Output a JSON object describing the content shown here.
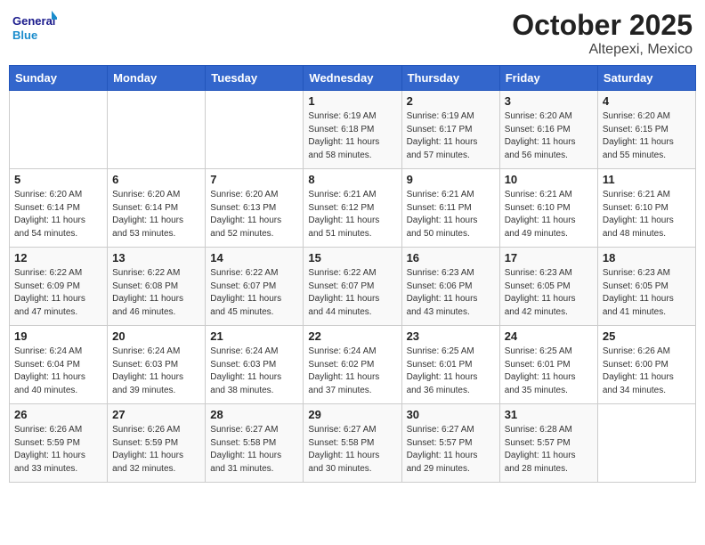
{
  "header": {
    "logo_line1": "General",
    "logo_line2": "Blue",
    "month_title": "October 2025",
    "location": "Altepexi, Mexico"
  },
  "days_of_week": [
    "Sunday",
    "Monday",
    "Tuesday",
    "Wednesday",
    "Thursday",
    "Friday",
    "Saturday"
  ],
  "weeks": [
    [
      {
        "day": "",
        "info": ""
      },
      {
        "day": "",
        "info": ""
      },
      {
        "day": "",
        "info": ""
      },
      {
        "day": "1",
        "info": "Sunrise: 6:19 AM\nSunset: 6:18 PM\nDaylight: 11 hours\nand 58 minutes."
      },
      {
        "day": "2",
        "info": "Sunrise: 6:19 AM\nSunset: 6:17 PM\nDaylight: 11 hours\nand 57 minutes."
      },
      {
        "day": "3",
        "info": "Sunrise: 6:20 AM\nSunset: 6:16 PM\nDaylight: 11 hours\nand 56 minutes."
      },
      {
        "day": "4",
        "info": "Sunrise: 6:20 AM\nSunset: 6:15 PM\nDaylight: 11 hours\nand 55 minutes."
      }
    ],
    [
      {
        "day": "5",
        "info": "Sunrise: 6:20 AM\nSunset: 6:14 PM\nDaylight: 11 hours\nand 54 minutes."
      },
      {
        "day": "6",
        "info": "Sunrise: 6:20 AM\nSunset: 6:14 PM\nDaylight: 11 hours\nand 53 minutes."
      },
      {
        "day": "7",
        "info": "Sunrise: 6:20 AM\nSunset: 6:13 PM\nDaylight: 11 hours\nand 52 minutes."
      },
      {
        "day": "8",
        "info": "Sunrise: 6:21 AM\nSunset: 6:12 PM\nDaylight: 11 hours\nand 51 minutes."
      },
      {
        "day": "9",
        "info": "Sunrise: 6:21 AM\nSunset: 6:11 PM\nDaylight: 11 hours\nand 50 minutes."
      },
      {
        "day": "10",
        "info": "Sunrise: 6:21 AM\nSunset: 6:10 PM\nDaylight: 11 hours\nand 49 minutes."
      },
      {
        "day": "11",
        "info": "Sunrise: 6:21 AM\nSunset: 6:10 PM\nDaylight: 11 hours\nand 48 minutes."
      }
    ],
    [
      {
        "day": "12",
        "info": "Sunrise: 6:22 AM\nSunset: 6:09 PM\nDaylight: 11 hours\nand 47 minutes."
      },
      {
        "day": "13",
        "info": "Sunrise: 6:22 AM\nSunset: 6:08 PM\nDaylight: 11 hours\nand 46 minutes."
      },
      {
        "day": "14",
        "info": "Sunrise: 6:22 AM\nSunset: 6:07 PM\nDaylight: 11 hours\nand 45 minutes."
      },
      {
        "day": "15",
        "info": "Sunrise: 6:22 AM\nSunset: 6:07 PM\nDaylight: 11 hours\nand 44 minutes."
      },
      {
        "day": "16",
        "info": "Sunrise: 6:23 AM\nSunset: 6:06 PM\nDaylight: 11 hours\nand 43 minutes."
      },
      {
        "day": "17",
        "info": "Sunrise: 6:23 AM\nSunset: 6:05 PM\nDaylight: 11 hours\nand 42 minutes."
      },
      {
        "day": "18",
        "info": "Sunrise: 6:23 AM\nSunset: 6:05 PM\nDaylight: 11 hours\nand 41 minutes."
      }
    ],
    [
      {
        "day": "19",
        "info": "Sunrise: 6:24 AM\nSunset: 6:04 PM\nDaylight: 11 hours\nand 40 minutes."
      },
      {
        "day": "20",
        "info": "Sunrise: 6:24 AM\nSunset: 6:03 PM\nDaylight: 11 hours\nand 39 minutes."
      },
      {
        "day": "21",
        "info": "Sunrise: 6:24 AM\nSunset: 6:03 PM\nDaylight: 11 hours\nand 38 minutes."
      },
      {
        "day": "22",
        "info": "Sunrise: 6:24 AM\nSunset: 6:02 PM\nDaylight: 11 hours\nand 37 minutes."
      },
      {
        "day": "23",
        "info": "Sunrise: 6:25 AM\nSunset: 6:01 PM\nDaylight: 11 hours\nand 36 minutes."
      },
      {
        "day": "24",
        "info": "Sunrise: 6:25 AM\nSunset: 6:01 PM\nDaylight: 11 hours\nand 35 minutes."
      },
      {
        "day": "25",
        "info": "Sunrise: 6:26 AM\nSunset: 6:00 PM\nDaylight: 11 hours\nand 34 minutes."
      }
    ],
    [
      {
        "day": "26",
        "info": "Sunrise: 6:26 AM\nSunset: 5:59 PM\nDaylight: 11 hours\nand 33 minutes."
      },
      {
        "day": "27",
        "info": "Sunrise: 6:26 AM\nSunset: 5:59 PM\nDaylight: 11 hours\nand 32 minutes."
      },
      {
        "day": "28",
        "info": "Sunrise: 6:27 AM\nSunset: 5:58 PM\nDaylight: 11 hours\nand 31 minutes."
      },
      {
        "day": "29",
        "info": "Sunrise: 6:27 AM\nSunset: 5:58 PM\nDaylight: 11 hours\nand 30 minutes."
      },
      {
        "day": "30",
        "info": "Sunrise: 6:27 AM\nSunset: 5:57 PM\nDaylight: 11 hours\nand 29 minutes."
      },
      {
        "day": "31",
        "info": "Sunrise: 6:28 AM\nSunset: 5:57 PM\nDaylight: 11 hours\nand 28 minutes."
      },
      {
        "day": "",
        "info": ""
      }
    ]
  ]
}
